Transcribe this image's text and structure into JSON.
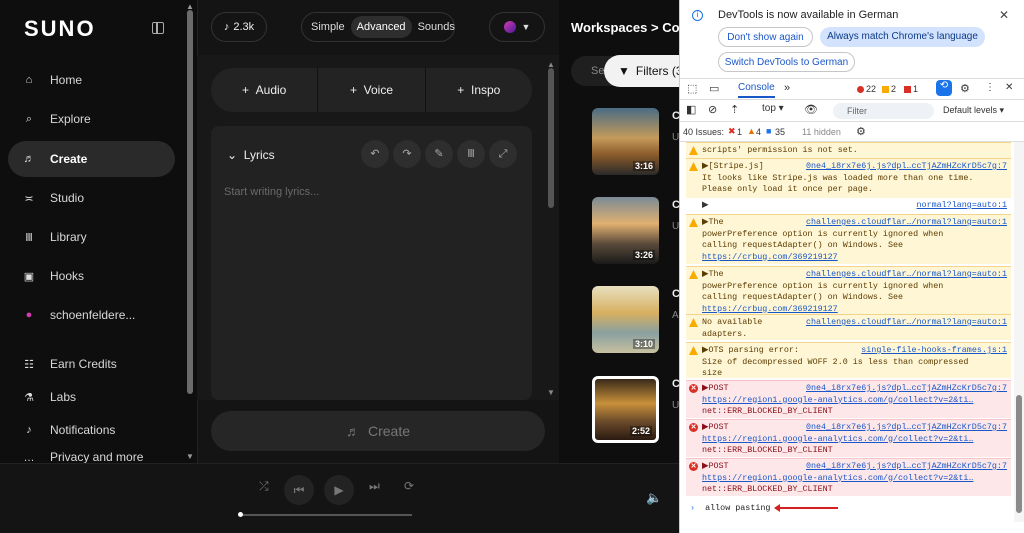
{
  "app": {
    "logo": "SUNO"
  },
  "sidebar": {
    "items": [
      {
        "label": "Home",
        "icon": "home-icon",
        "glyph": "⌂"
      },
      {
        "label": "Explore",
        "icon": "search-icon",
        "glyph": "⌕"
      },
      {
        "label": "Create",
        "icon": "create-icon",
        "glyph": "♬"
      },
      {
        "label": "Studio",
        "icon": "studio-icon",
        "glyph": "≍"
      },
      {
        "label": "Library",
        "icon": "library-icon",
        "glyph": "Ⅲ"
      },
      {
        "label": "Hooks",
        "icon": "hooks-icon",
        "glyph": "▣"
      },
      {
        "label": "schoenfeldere...",
        "icon": "user-avatar-icon",
        "glyph": "●"
      },
      {
        "label": "Earn Credits",
        "icon": "credits-icon",
        "glyph": "☷"
      },
      {
        "label": "Labs",
        "icon": "labs-icon",
        "glyph": "⚗"
      },
      {
        "label": "Notifications",
        "icon": "bell-icon",
        "glyph": "♪"
      },
      {
        "label": "Privacy and more",
        "icon": "more-icon",
        "glyph": "…"
      }
    ]
  },
  "create": {
    "credits": "2.3k",
    "modes": [
      "Simple",
      "Advanced",
      "Sounds"
    ],
    "add_buttons": [
      "Audio",
      "Voice",
      "Inspo"
    ],
    "lyrics_title": "Lyrics",
    "lyrics_placeholder": "Start writing lyrics...",
    "create_label": "Create"
  },
  "workspace": {
    "title": "Workspaces",
    "crumb": "Co",
    "search_prefix": "Se",
    "filters_label": "Filters (3",
    "tracks": [
      {
        "duration": "3:16",
        "initial": "C",
        "sub": "U"
      },
      {
        "duration": "3:26",
        "initial": "C",
        "sub": "U"
      },
      {
        "duration": "3:10",
        "initial": "C",
        "sub": "A"
      },
      {
        "duration": "2:52",
        "initial": "C",
        "sub": "U"
      }
    ]
  },
  "devtools": {
    "info_text": "DevTools is now available in German",
    "btn_dont_show": "Don't show again",
    "btn_match": "Always match Chrome's language",
    "btn_switch": "Switch DevTools to German",
    "tab_console": "Console",
    "errors": "22",
    "warnings": "2",
    "info_count": "1",
    "context": "top",
    "filter_placeholder": "Filter",
    "levels": "Default levels",
    "issues_label": "40 Issues:",
    "issues_err": "1",
    "issues_warn": "4",
    "issues_info": "35",
    "hidden": "11 hidden",
    "messages": [
      {
        "type": "warn",
        "lines": [
          "scripts' permission is not set."
        ],
        "src": ""
      },
      {
        "type": "warn",
        "lines": [
          "▶[Stripe.js] ",
          "It looks like Stripe.js was loaded more than one time.",
          "Please only load it once per page."
        ],
        "src": "0ne4_i8rx7e6j.js?dpl…ccTjAZmHZcKrD5c7g:7"
      },
      {
        "type": "plain",
        "lines": [
          "▶"
        ],
        "src": "normal?lang=auto:1"
      },
      {
        "type": "warn",
        "lines": [
          "▶The ",
          "powerPreference option is currently ignored when",
          "calling requestAdapter() on Windows. See"
        ],
        "link": "https://crbug.com/369219127",
        "src": "challenges.cloudflar…/normal?lang=auto:1"
      },
      {
        "type": "warn",
        "lines": [
          "▶The ",
          "powerPreference option is currently ignored when",
          "calling requestAdapter() on Windows. See"
        ],
        "link": "https://crbug.com/369219127",
        "src": "challenges.cloudflar…/normal?lang=auto:1"
      },
      {
        "type": "warn",
        "lines": [
          "No available ",
          "adapters."
        ],
        "src": "challenges.cloudflar…/normal?lang=auto:1"
      },
      {
        "type": "warn",
        "lines": [
          "▶OTS parsing error: ",
          "Size of decompressed WOFF 2.0 is less than compressed",
          "size"
        ],
        "src": "single-file-hooks-frames.js:1"
      },
      {
        "type": "err",
        "lines": [
          "▶POST "
        ],
        "link": "https://region1.google-analytics.com/g/collect?v=2&ti…",
        "tail": "net::ERR_BLOCKED_BY_CLIENT",
        "src": "0ne4_i8rx7e6j.js?dpl…ccTjAZmHZcKrD5c7g:7"
      },
      {
        "type": "err",
        "lines": [
          "▶POST "
        ],
        "link": "https://region1.google-analytics.com/g/collect?v=2&ti…",
        "tail": "net::ERR_BLOCKED_BY_CLIENT",
        "src": "0ne4_i8rx7e6j.js?dpl…ccTjAZmHZcKrD5c7g:7"
      },
      {
        "type": "err",
        "lines": [
          "▶POST "
        ],
        "link": "https://region1.google-analytics.com/g/collect?v=2&ti…",
        "tail": "net::ERR_BLOCKED_BY_CLIENT",
        "src": "0ne4_i8rx7e6j.js?dpl…ccTjAZmHZcKrD5c7g:7"
      }
    ],
    "prompt": "allow pasting"
  }
}
